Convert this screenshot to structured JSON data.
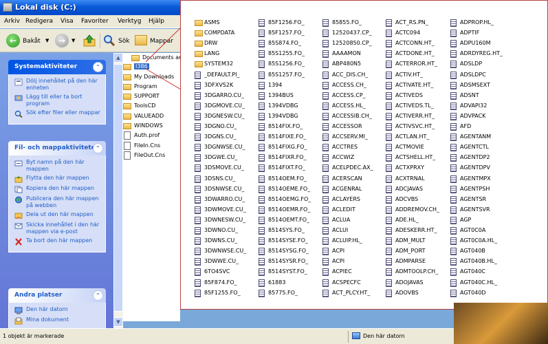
{
  "window": {
    "title": "Lokal disk (C:)"
  },
  "menu": [
    "Arkiv",
    "Redigera",
    "Visa",
    "Favoriter",
    "Verktyg",
    "Hjälp"
  ],
  "toolbar": {
    "back_label": "Bakåt",
    "search_label": "Sök",
    "folders_label": "Mappar"
  },
  "tasks": {
    "system_title": "Systemaktiviteter",
    "system_items": [
      "Dölj innehållet på den här enheten",
      "Lägg till eller ta bort program",
      "Sök efter filer eller mappar"
    ],
    "file_title": "Fil- och mappaktiviteter",
    "file_items": [
      "Byt namn på den här mappen",
      "Flytta den här mappen",
      "Kopiera den här mappen",
      "Publicera den här mappen på webben",
      "Dela ut den här mappen",
      "Skicka innehållet i den här mappen via e-post",
      "Ta bort den här mappen"
    ],
    "other_title": "Andra platser",
    "other_items": [
      "Den här datorn",
      "Mina dokument"
    ]
  },
  "tree": [
    {
      "label": "Documents and S",
      "kind": "folder"
    },
    {
      "label": "I386",
      "kind": "folder",
      "selected": true
    },
    {
      "label": "My Downloads",
      "kind": "folder"
    },
    {
      "label": "Program",
      "kind": "folder"
    },
    {
      "label": "SUPPORT",
      "kind": "folder"
    },
    {
      "label": "ToolsCD",
      "kind": "folder"
    },
    {
      "label": "VALUEADD",
      "kind": "folder"
    },
    {
      "label": "WINDOWS",
      "kind": "folder"
    },
    {
      "label": "Auth.prof",
      "kind": "file"
    },
    {
      "label": "FileIn.Cns",
      "kind": "file"
    },
    {
      "label": "FileOut.Cns",
      "kind": "file"
    }
  ],
  "status": {
    "left": "1 objekt är markerade",
    "right": "Den här datorn"
  },
  "files": [
    [
      "ASMS",
      "COMPDATA",
      "DRW",
      "LANG",
      "SYSTEM32",
      "_DEFAULT.PI_",
      "3DFXVS2K",
      "3DGARRO.CU_",
      "3DGMOVE.CU_",
      "3DGNESW.CU_",
      "3DGNO.CU_",
      "3DGNS.CU_",
      "3DGNWSE.CU_",
      "3DGWE.CU_",
      "3DSMOVE.CU_",
      "3DSNS.CU_",
      "3DSNWSE.CU_",
      "3DWARRO.CU_",
      "3DWMOVE.CU_",
      "3DWNESW.CU_",
      "3DWNO.CU_",
      "3DWNS.CU_",
      "3DWNWSE.CU_",
      "3DWWE.CU_",
      "6TO4SVC",
      "85F874.FO_",
      "85F1255.FO_"
    ],
    [
      "85F1256.FO_",
      "85F1257.FO_",
      "85S874.FO_",
      "85S1255.FO_",
      "85S1256.FO_",
      "85S1257.FO_",
      "1394",
      "1394BUS",
      "1394VDBG",
      "1394VDBG",
      "8514FIX.FO_",
      "8514FIXE.FO_",
      "8514FIXG.FO_",
      "8514FIXR.FO_",
      "8514FIXT.FO_",
      "8514OEM.FO_",
      "8514OEME.FO_",
      "8514OEMG.FO_",
      "8514OEMR.FO_",
      "8514OEMT.FO_",
      "8514SYS.FO_",
      "8514SYSE.FO_",
      "8514SYSG.FO_",
      "8514SYSR.FO_",
      "8514SYST.FO_",
      "61883",
      "85775.FO_"
    ],
    [
      "85855.FO_",
      "12520437.CP_",
      "12520850.CP_",
      "AAAAMON",
      "ABP480N5",
      "ACC_DIS.CH_",
      "ACCESS.CH_",
      "ACCESS.CP_",
      "ACCESS.HL_",
      "ACCESSIB.CH_",
      "ACCESSOR",
      "ACCSERV.MI_",
      "ACCTRES",
      "ACCWIZ",
      "ACELPDEC.AX_",
      "ACERSCAN",
      "ACGENRAL",
      "ACLAYERS",
      "ACLEDIT",
      "ACLUA",
      "ACLUI",
      "ACLUIP.HL_",
      "ACPI",
      "ACPI",
      "ACPIEC",
      "ACSPECFC",
      "ACT_PLCY.HT_"
    ],
    [
      "ACT_RS.PN_",
      "ACTC094",
      "ACTCONN.HT_",
      "ACTDONE.HT_",
      "ACTERROR.HT_",
      "ACTIV.HT_",
      "ACTIVATE.HT_",
      "ACTIVEDS",
      "ACTIVEDS.TL_",
      "ACTIVERR.HT_",
      "ACTIVSVC.HT_",
      "ACTLAN.HT_",
      "ACTMOVIE",
      "ACTSHELL.HT_",
      "ACTXPRXY",
      "ACXTRNAL",
      "ADCJAVAS",
      "ADCVBS",
      "ADDREMOV.CH_",
      "ADE.HL_",
      "ADESKERR.HT_",
      "ADM_MULT",
      "ADM_PORT",
      "ADMPARSE",
      "ADMTOOLP.CH_",
      "ADOJAVAS",
      "ADOVBS"
    ],
    [
      "ADPROP.HL_",
      "ADPTIF",
      "ADPU160M",
      "ADRDYREG.HT_",
      "ADSLDP",
      "ADSLDPC",
      "ADSMSEXT",
      "ADSNT",
      "ADVAPI32",
      "ADVPACK",
      "AFD",
      "AGENTANM",
      "AGENTCTL",
      "AGENTDP2",
      "AGENTDPV",
      "AGENTMPX",
      "AGENTPSH",
      "AGENTSR",
      "AGENTSVR",
      "AGP",
      "AGT0C0A",
      "AGT0C0A.HL_",
      "AGT040B",
      "AGT040B.HL_",
      "AGT040C",
      "AGT040C.HL_",
      "AGT040D"
    ]
  ]
}
